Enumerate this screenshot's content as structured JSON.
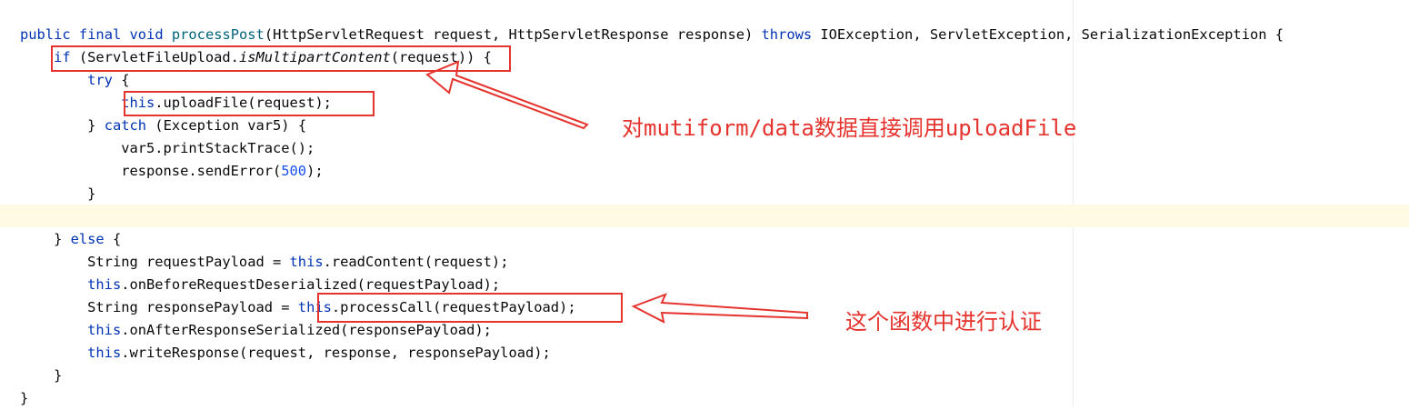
{
  "code": {
    "l1": {
      "kw1": "public",
      "kw2": "final",
      "kw3": "void",
      "fn": "processPost",
      "a": "(HttpServletRequest request, HttpServletResponse response) ",
      "kw4": "throws",
      "b": " IOException, ServletException, SerializationException {"
    },
    "l2": {
      "kw": "if",
      "a": " (ServletFileUpload.",
      "it": "isMultipartContent",
      "b": "(request)) {"
    },
    "l3": {
      "kw": "try",
      "a": " {"
    },
    "l4": {
      "kw": "this",
      "a": ".uploadFile(request);"
    },
    "l5": {
      "a": "} ",
      "kw": "catch",
      "b": " (Exception var5) {"
    },
    "l6": {
      "a": "var5.printStackTrace();"
    },
    "l7": {
      "a": "response.sendError(",
      "num": "500",
      "b": ");"
    },
    "l8": {
      "a": "}"
    },
    "l9": {
      "a": ""
    },
    "l10": {
      "a": "} ",
      "kw": "else",
      "b": " {"
    },
    "l11": {
      "a": "String requestPayload = ",
      "kw": "this",
      "b": ".readContent(request);"
    },
    "l12": {
      "kw": "this",
      "a": ".onBeforeRequestDeserialized(requestPayload);"
    },
    "l13": {
      "a": "String responsePayload = ",
      "kw": "this",
      "b": ".processCall(requestPayload);"
    },
    "l14": {
      "kw": "this",
      "a": ".onAfterResponseSerialized(responsePayload);"
    },
    "l15": {
      "kw": "this",
      "a": ".writeResponse(request, response, responsePayload);"
    },
    "l16": {
      "a": "}"
    },
    "l17": {
      "a": "}"
    }
  },
  "annotations": {
    "note1": "对mutiform/data数据直接调用uploadFile",
    "note2": "这个函数中进行认证"
  },
  "colors": {
    "keyword": "#0033b3",
    "method": "#00627a",
    "number": "#1750eb",
    "annotation": "#e5332e",
    "caret_row": "#fffae3"
  }
}
